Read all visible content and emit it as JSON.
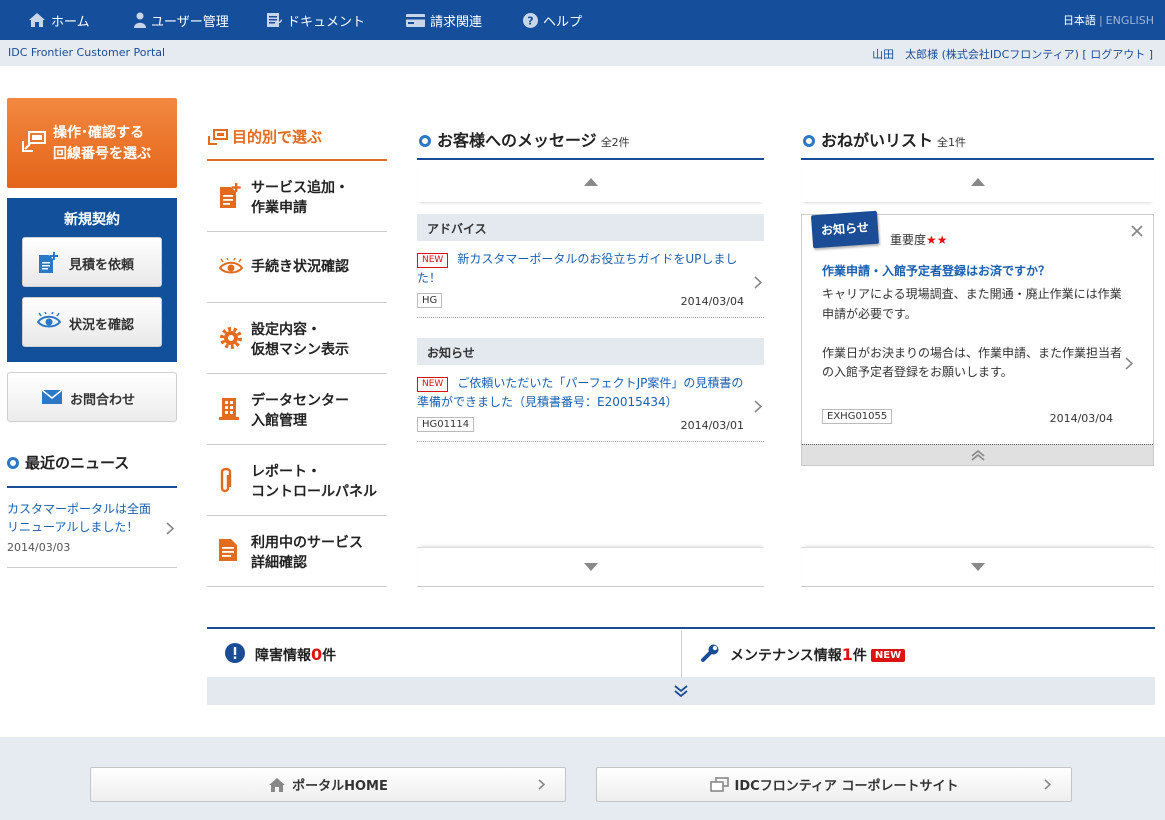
{
  "nav": {
    "items": [
      {
        "label": "ホーム",
        "icon": "home-icon"
      },
      {
        "label": "ユーザー管理",
        "icon": "user-icon"
      },
      {
        "label": "ドキュメント",
        "icon": "document-icon"
      },
      {
        "label": "請求関連",
        "icon": "billing-icon"
      },
      {
        "label": "ヘルプ",
        "icon": "help-icon"
      }
    ],
    "lang_active": "日本語",
    "lang_inactive": "ENGLISH"
  },
  "subheader": {
    "portal_name": "IDC Frontier Customer Portal",
    "user": "山田　太郎様 (株式会社IDCフロンティア) [",
    "logout": " ログアウト ",
    "user_end": "]"
  },
  "sidebar": {
    "line_select_1": "操作･確認する",
    "line_select_2": "回線番号を選ぶ",
    "new_contract_title": "新規契約",
    "estimate_label": "見積を依頼",
    "status_label": "状況を確認",
    "contact_label": "お問合わせ",
    "news_title": "最近のニュース",
    "news_items": [
      {
        "title": "カスタマーポータルは全面リニューアルしました！",
        "date": "2014/03/03"
      }
    ]
  },
  "purpose": {
    "title": "目的別で選ぶ",
    "items": [
      {
        "line1": "サービス追加・",
        "line2": "作業申請",
        "icon": "add-document-icon"
      },
      {
        "line1": "手続き状況確認",
        "line2": "",
        "icon": "eye-icon"
      },
      {
        "line1": "設定内容・",
        "line2": "仮想マシン表示",
        "icon": "gear-icon"
      },
      {
        "line1": "データセンター",
        "line2": "入館管理",
        "icon": "building-icon"
      },
      {
        "line1": "レポート・",
        "line2": "コントロールパネル",
        "icon": "paperclip-icon"
      },
      {
        "line1": "利用中のサービス",
        "line2": "詳細確認",
        "icon": "document-icon"
      }
    ]
  },
  "messages": {
    "title": "お客様へのメッセージ",
    "count": "全2件",
    "groups": [
      {
        "category": "アドバイス",
        "badge": "NEW",
        "text": "新カスタマーポータルのお役立ちガイドをUPしました！",
        "code": "HG",
        "date": "2014/03/04"
      },
      {
        "category": "お知らせ",
        "badge": "NEW",
        "text": "ご依頼いただいた「パーフェクトJP案件」の見積書の準備ができました（見積書番号：E20015434）",
        "code": "HG01114",
        "date": "2014/03/01"
      }
    ]
  },
  "requests": {
    "title": "おねがいリスト",
    "count": "全1件",
    "card": {
      "tag": "お知らせ",
      "priority_label": "重要度",
      "stars": "★★",
      "headline": "作業申請・入館予定者登録はお済ですか？",
      "body1": "キャリアによる現場調査、また開通・廃止作業には作業申請が必要です。",
      "body2": "作業日がお決まりの場合は、作業申請、また作業担当者の入館予定者登録をお願いします。",
      "code": "EXHG01055",
      "date": "2014/03/04"
    }
  },
  "status": {
    "incident_label": "障害情報",
    "incident_count": "0",
    "incident_unit": "件",
    "maintenance_label": "メンテナンス情報",
    "maintenance_count": "1",
    "maintenance_unit": "件",
    "maintenance_badge": "NEW"
  },
  "footer": {
    "portal_home": "ポータルHOME",
    "corporate_site": "IDCフロンティア コーポレートサイト"
  },
  "colors": {
    "brand_blue": "#154f9c",
    "accent_orange": "#e46419",
    "alert_red": "#dd1111"
  }
}
